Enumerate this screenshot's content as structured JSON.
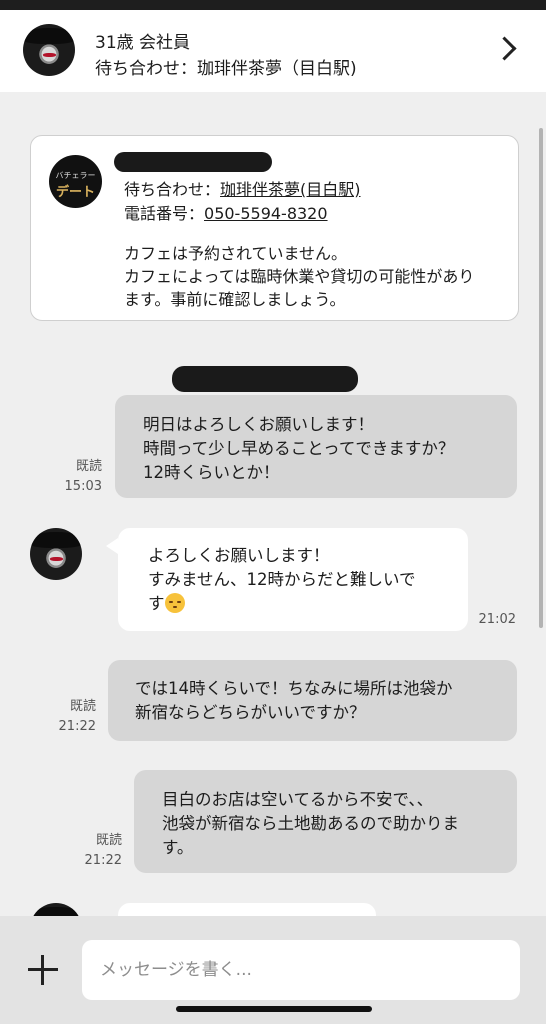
{
  "header": {
    "line1": "31歳 会社員",
    "line2": "待ち合わせ：珈琲伴茶夢（目白駅)"
  },
  "info_card": {
    "logo_small": "バチェラー",
    "logo_big": "デート",
    "meeting_label": "待ち合わせ：",
    "meeting_place": "珈琲伴茶夢(目白駅)",
    "phone_label": "電話番号：",
    "phone": "050-5594-8320",
    "note_line1": "カフェは予約されていません。",
    "note_line2": "カフェによっては臨時休業や貸切の可能性があり",
    "note_line3": "ます。事前に確認しましょう。"
  },
  "messages": [
    {
      "type": "sent",
      "lines": [
        "明日はよろしくお願いします！",
        "時間って少し早めることってできますか？",
        "12時くらいとか！"
      ],
      "read": "既読",
      "time": "15:03"
    },
    {
      "type": "received",
      "lines": [
        "よろしくお願いします！",
        "すみません、12時からだと難しいで",
        "す"
      ],
      "emoji": "relieved-face",
      "time": "21:02"
    },
    {
      "type": "sent",
      "lines": [
        "では14時くらいで！ちなみに場所は池袋か",
        "新宿ならどちらがいいですか？"
      ],
      "read": "既読",
      "time": "21:22"
    },
    {
      "type": "sent",
      "lines": [
        "目白のお店は空いてるから不安で、、",
        "池袋が新宿なら土地勘あるので助かりま",
        "す。"
      ],
      "read": "既読",
      "time": "21:22"
    }
  ],
  "composer": {
    "placeholder": "メッセージを書く..."
  }
}
